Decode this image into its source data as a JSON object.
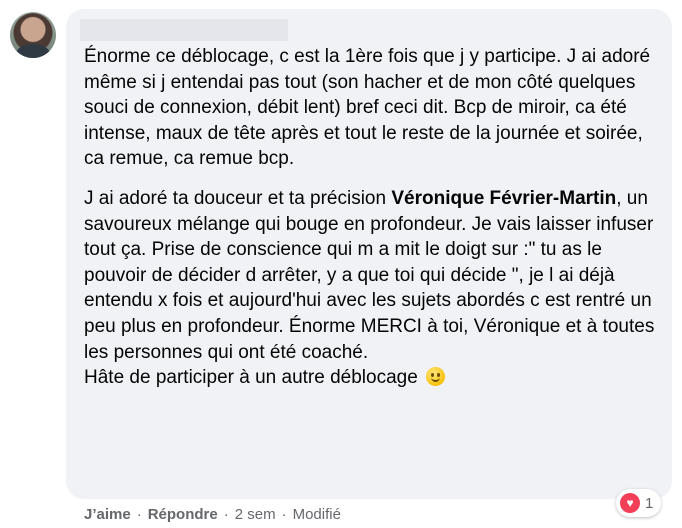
{
  "comment": {
    "paragraphs": [
      "Énorme ce déblocage, c est la 1ère fois que j y participe. J ai adoré même si j entendai pas tout (son hacher et de mon côté quelques souci de connexion, débit lent) bref ceci dit. Bcp de miroir, ca été intense, maux de tête après et tout le reste de la journée et soirée, ca remue, ca remue bcp."
    ],
    "para2_before": "J ai adoré ta douceur et ta précision ",
    "mention": "Véronique Février-Martin",
    "para2_after": ", un savoureux mélange qui bouge en profondeur. Je vais laisser infuser tout ça. Prise de conscience qui m a mit le doigt sur :\" tu as le pouvoir de décider d arrêter, y a que toi qui décide \", je l ai déjà entendu x fois et aujourd'hui avec les sujets abordés c est rentré un peu plus en profondeur. Énorme MERCI à toi, Véronique et à toutes les personnes qui ont été coaché.",
    "para2_last": "Hâte de participer à un autre déblocage",
    "emoji_icon": "slightly-smiling-face-emoji"
  },
  "reactions": {
    "icon": "heart-icon",
    "count": "1",
    "color": "#f33e58"
  },
  "actions": {
    "like": "J’aime",
    "reply": "Répondre",
    "separator": "·",
    "time": "2 sem",
    "edited": "Modifié"
  }
}
